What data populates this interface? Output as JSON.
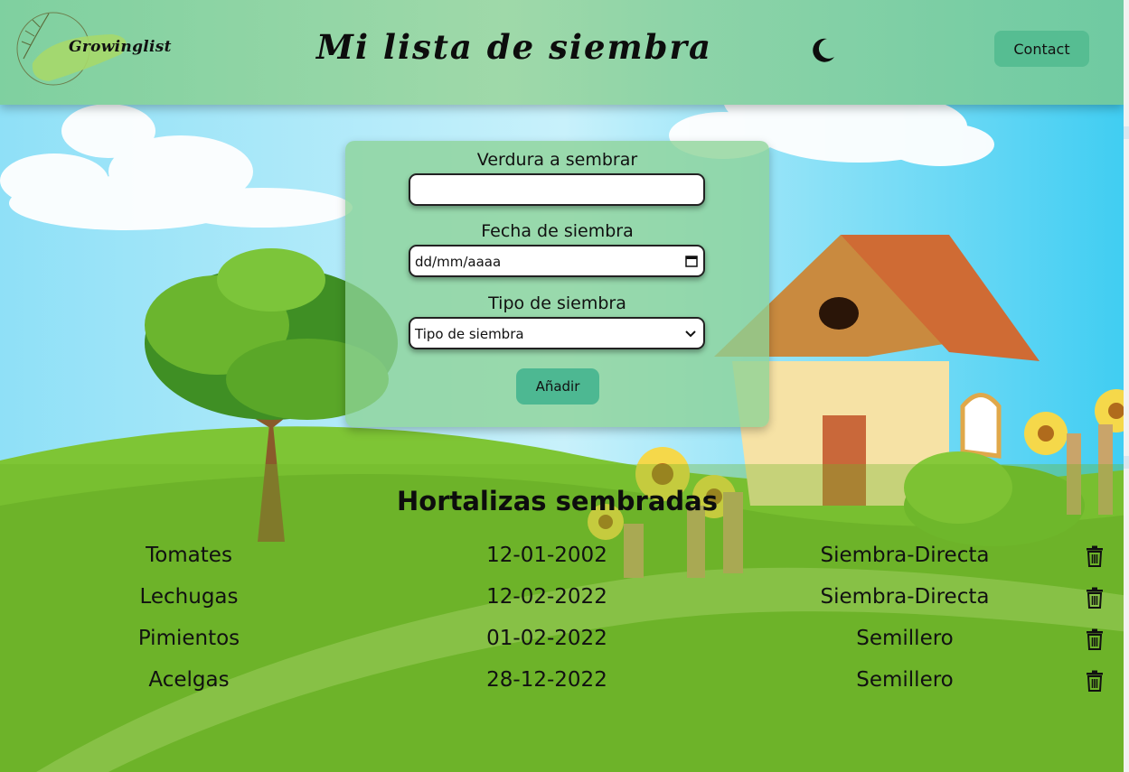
{
  "header": {
    "logo_text": "Growinglist",
    "title": "Mi lista de siembra",
    "theme_toggle_icon": "moon-icon",
    "contact_label": "Contact"
  },
  "form": {
    "vegetable_label": "Verdura a sembrar",
    "vegetable_value": "",
    "date_label": "Fecha de siembra",
    "date_placeholder": "dd/mm/aaaa",
    "type_label": "Tipo de siembra",
    "type_selected": "Tipo de siembra",
    "add_label": "Añadir"
  },
  "list": {
    "title": "Hortalizas sembradas",
    "rows": [
      {
        "name": "Tomates",
        "date": "12-01-2002",
        "type": "Siembra-Directa"
      },
      {
        "name": "Lechugas",
        "date": "12-02-2022",
        "type": "Siembra-Directa"
      },
      {
        "name": "Pimientos",
        "date": "01-02-2022",
        "type": "Semillero"
      },
      {
        "name": "Acelgas",
        "date": "28-12-2022",
        "type": "Semillero"
      }
    ]
  },
  "colors": {
    "header_green": "#8ed4a8",
    "button_green": "#4db892",
    "sky": "#5fd3f5",
    "grass": "#72b92b"
  }
}
